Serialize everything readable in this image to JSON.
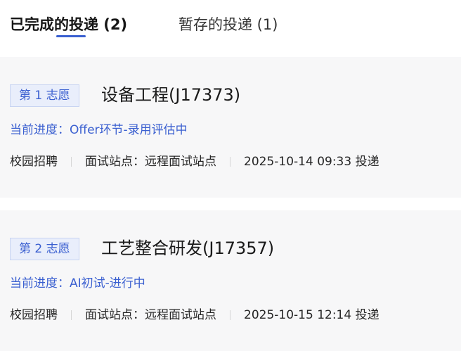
{
  "tabs": [
    {
      "label": "已完成的投递 (2)",
      "active": true
    },
    {
      "label": "暂存的投递 (1)",
      "active": false
    }
  ],
  "colors": {
    "accent": "#3a5fd0",
    "badge_bg": "#e9eefb",
    "card_bg": "#f7f7f8"
  },
  "applications": [
    {
      "choice": "第 1 志愿",
      "title": "设备工程(J17373)",
      "progress": "当前进度：Offer环节-录用评估中",
      "type": "校园招聘",
      "site": "面试站点：远程面试站点",
      "submitted": "2025-10-14 09:33 投递"
    },
    {
      "choice": "第 2 志愿",
      "title": "工艺整合研发(J17357)",
      "progress": "当前进度：AI初试-进行中",
      "type": "校园招聘",
      "site": "面试站点：远程面试站点",
      "submitted": "2025-10-15 12:14 投递"
    }
  ]
}
